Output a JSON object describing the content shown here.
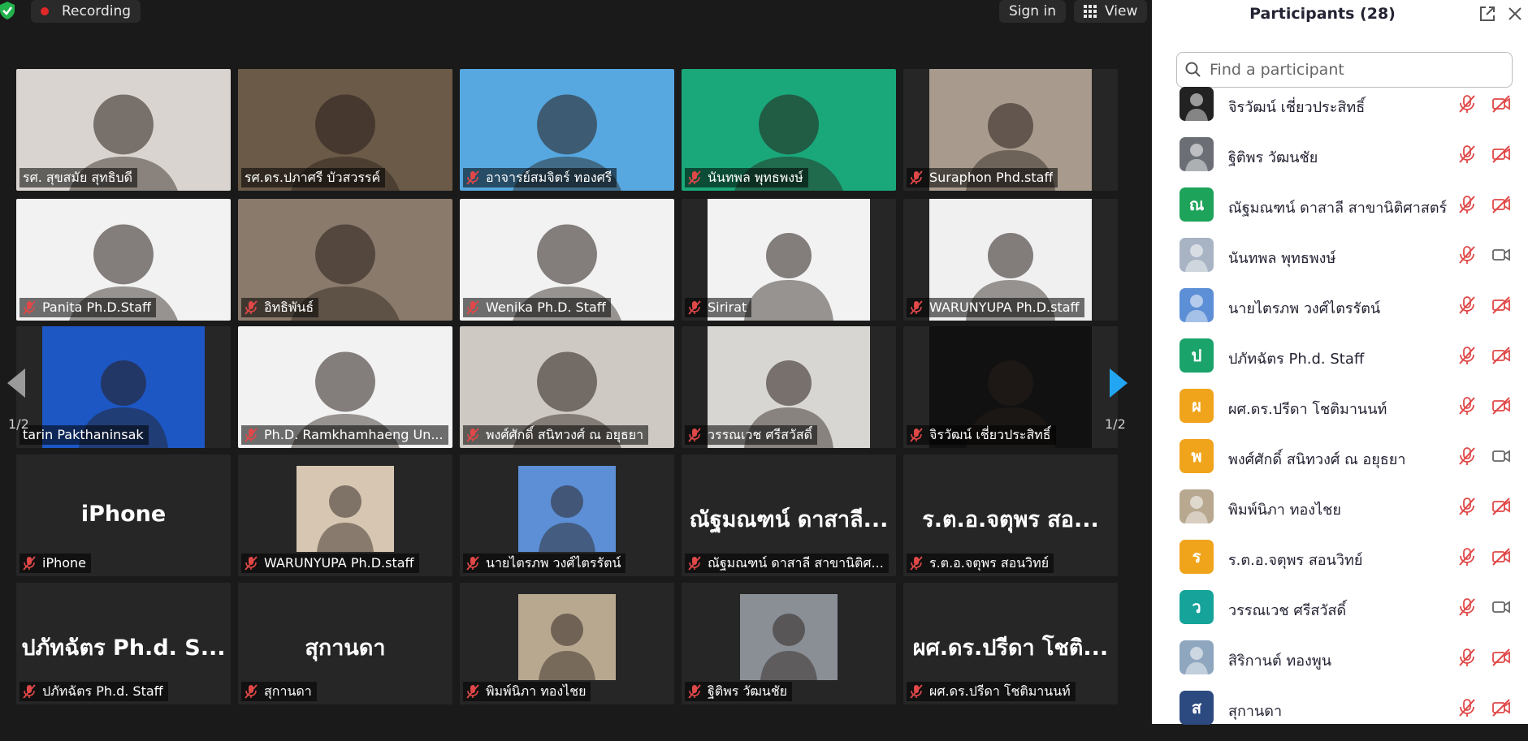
{
  "topbar": {
    "recording_label": "Recording",
    "signin_label": "Sign in",
    "view_label": "View"
  },
  "nav": {
    "left_page": "1/2",
    "right_page": "1/2"
  },
  "tiles": [
    {
      "name": "รศ. สุขสมัย สุทธิบดี",
      "muted": false,
      "kind": "video",
      "bg": "#d9d4cf"
    },
    {
      "name": "รศ.ดร.ปภาศรี บัวสวรรค์",
      "muted": false,
      "kind": "video",
      "bg": "#6b5a48",
      "active": true
    },
    {
      "name": "อาจารย์สมจิตร์ ทองศรี",
      "muted": true,
      "kind": "video",
      "bg": "#57a8e0"
    },
    {
      "name": "นันทพล พุทธพงษ์",
      "muted": true,
      "kind": "video",
      "bg": "#1aa87a"
    },
    {
      "name": "Suraphon Phd.staff",
      "muted": true,
      "kind": "video",
      "bg": "#a89b8e",
      "inset": true
    },
    {
      "name": "Panita Ph.D.Staff",
      "muted": true,
      "kind": "video",
      "bg": "#f2f2f2"
    },
    {
      "name": "อิทธิพันธ์",
      "muted": true,
      "kind": "video",
      "bg": "#8a7a6c"
    },
    {
      "name": "Wenika Ph.D. Staff",
      "muted": true,
      "kind": "video",
      "bg": "#f2f2f2"
    },
    {
      "name": "Sirirat",
      "muted": true,
      "kind": "video",
      "bg": "#f2f2f2",
      "inset": true
    },
    {
      "name": "WARUNYUPA Ph.D.staff",
      "muted": true,
      "kind": "video",
      "bg": "#f0f0f0",
      "inset": true
    },
    {
      "name": "tarin Pakthaninsak",
      "muted": false,
      "kind": "video",
      "bg": "#1d57c4",
      "inset": true
    },
    {
      "name": "Ph.D. Ramkhamhaeng Un...",
      "muted": true,
      "kind": "video",
      "bg": "#f2f2f2"
    },
    {
      "name": "พงศ์ศักดิ์ สนิทวงศ์ ณ อยุธยา",
      "muted": true,
      "kind": "video",
      "bg": "#cfc9c4"
    },
    {
      "name": "วรรณเวช ศรีสวัสดิ์",
      "muted": true,
      "kind": "video",
      "bg": "#d8d6d2",
      "inset": true
    },
    {
      "name": "จิรวัฒน์ เชี่ยวประสิทธิ์",
      "muted": true,
      "kind": "video",
      "bg": "#111111",
      "inset": true
    },
    {
      "name": "iPhone",
      "muted": true,
      "kind": "text",
      "big": "iPhone"
    },
    {
      "name": "WARUNYUPA Ph.D.staff",
      "muted": true,
      "kind": "photo",
      "bg": "#d7c7b2"
    },
    {
      "name": "นายไตรภพ วงศ์ไตรรัตน์",
      "muted": true,
      "kind": "photo",
      "bg": "#5c8fd6"
    },
    {
      "name": "ณัฐมณฑน์ ดาสาลี สาขานิติศ...",
      "muted": true,
      "kind": "text",
      "big": "ณัฐมณฑน์ ดาสาลี..."
    },
    {
      "name": "ร.ต.อ.จตุพร  สอนวิทย์",
      "muted": true,
      "kind": "text",
      "big": "ร.ต.อ.จตุพร  สอ..."
    },
    {
      "name": "ปภัทฉัตร Ph.d. Staff",
      "muted": true,
      "kind": "text",
      "big": "ปภัทฉัตร Ph.d. S..."
    },
    {
      "name": "สุกานดา",
      "muted": true,
      "kind": "text",
      "big": "สุกานดา"
    },
    {
      "name": "พิมพ์นิภา ทองไชย",
      "muted": true,
      "kind": "photo",
      "bg": "#b8a890"
    },
    {
      "name": "ฐิติพร วัฒนชัย",
      "muted": true,
      "kind": "photo",
      "bg": "#8a8f96"
    },
    {
      "name": "ผศ.ดร.ปรีดา โชติมานนท์",
      "muted": true,
      "kind": "text",
      "big": "ผศ.ดร.ปรีดา โชติ..."
    }
  ],
  "panel": {
    "title": "Participants (28)",
    "search_placeholder": "Find a participant",
    "participants": [
      {
        "name": "จิรวัฒน์ เชี่ยวประสิทธิ์",
        "avatar": "",
        "color": "#222222",
        "video_off": true
      },
      {
        "name": "ฐิติพร วัฒนชัย",
        "avatar": "",
        "color": "#6b6f75",
        "video_off": true
      },
      {
        "name": "ณัฐมณฑน์ ดาสาลี สาขานิติศาสตร์",
        "avatar": "ณ",
        "color": "#1ea35a",
        "video_off": true
      },
      {
        "name": "นันทพล พุทธพงษ์",
        "avatar": "",
        "color": "#a8b4c4",
        "video_off": false
      },
      {
        "name": "นายไตรภพ วงศ์ไตรรัตน์",
        "avatar": "",
        "color": "#5c8fd6",
        "video_off": true
      },
      {
        "name": "ปภัทฉัตร Ph.d. Staff",
        "avatar": "ป",
        "color": "#1aa36a",
        "video_off": true
      },
      {
        "name": "ผศ.ดร.ปรีดา โชติมานนท์",
        "avatar": "ผ",
        "color": "#f0a41c",
        "video_off": true
      },
      {
        "name": "พงศ์ศักดิ์ สนิทวงศ์ ณ อยุธยา",
        "avatar": "พ",
        "color": "#f0a41c",
        "video_off": false
      },
      {
        "name": "พิมพ์นิภา ทองไชย",
        "avatar": "",
        "color": "#b8a890",
        "video_off": true
      },
      {
        "name": "ร.ต.อ.จตุพร  สอนวิทย์",
        "avatar": "ร",
        "color": "#f0a41c",
        "video_off": true
      },
      {
        "name": "วรรณเวช ศรีสวัสดิ์",
        "avatar": "ว",
        "color": "#16a39a",
        "video_off": false
      },
      {
        "name": "สิริกานต์ ทองพูน",
        "avatar": "",
        "color": "#8fa6bf",
        "video_off": true
      },
      {
        "name": "สุกานดา",
        "avatar": "ส",
        "color": "#2d4a80",
        "video_off": true
      }
    ]
  }
}
